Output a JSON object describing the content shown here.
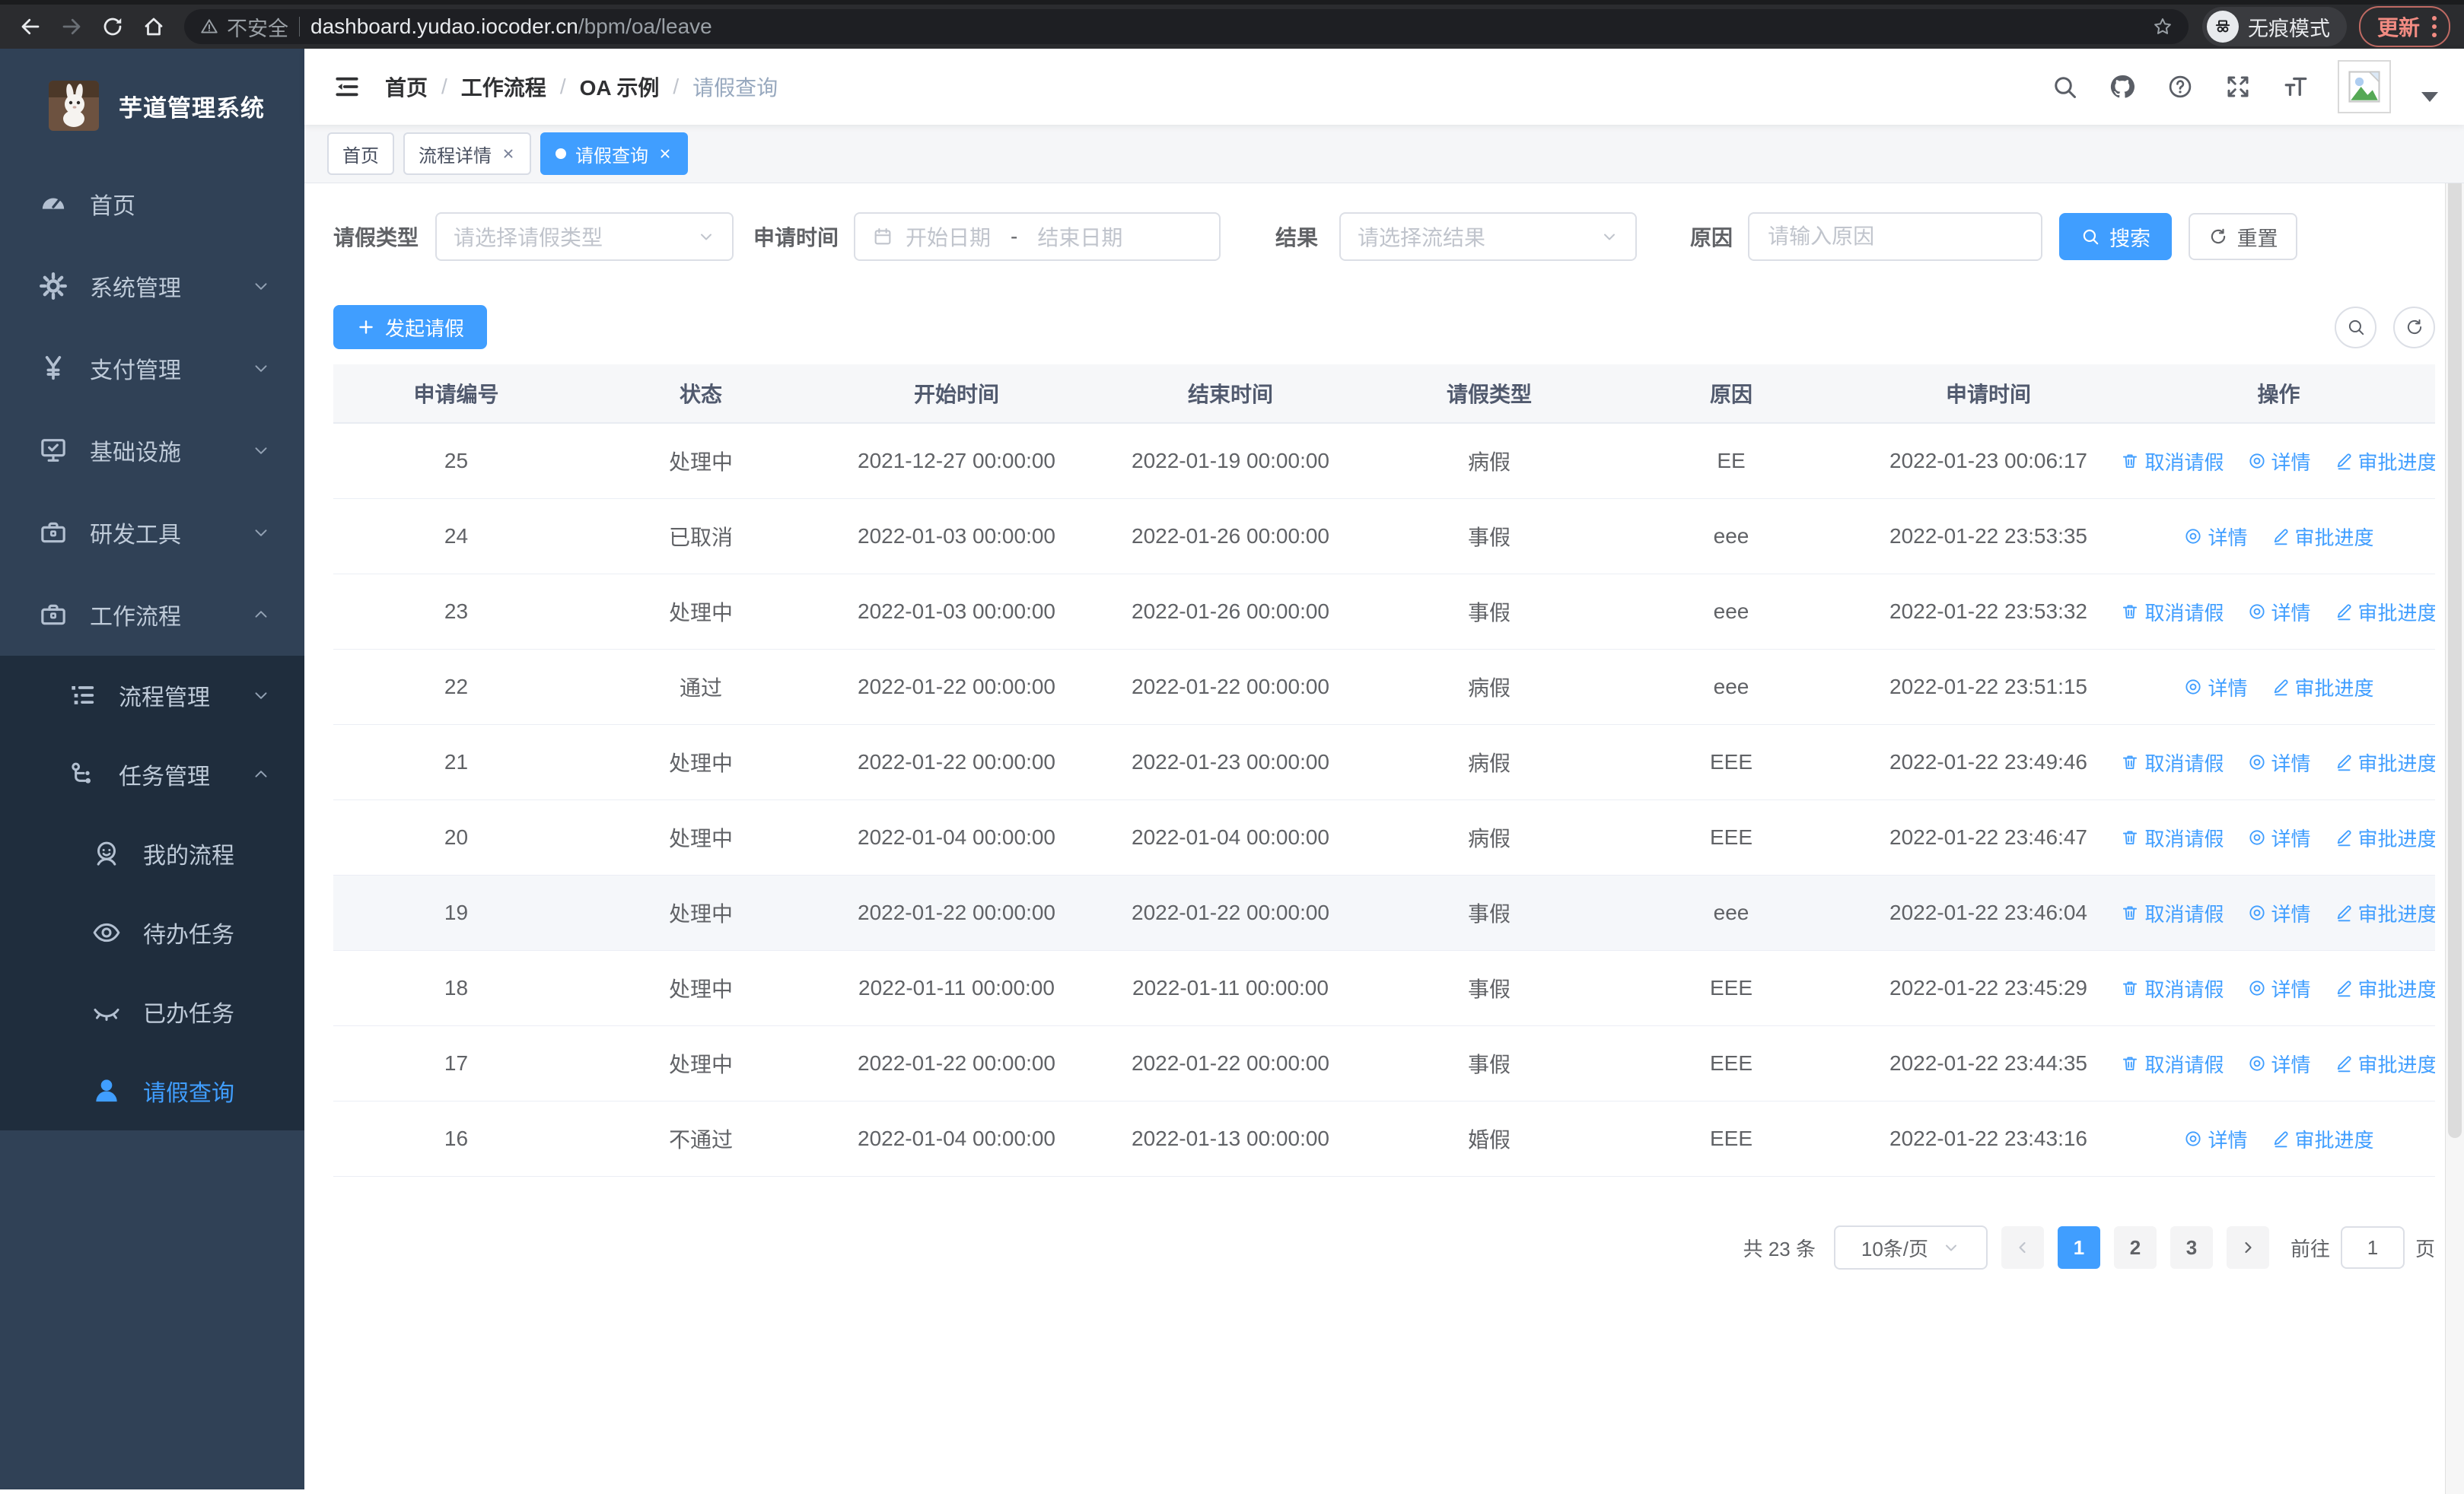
{
  "browser": {
    "security_label": "不安全",
    "url_host": "dashboard.yudao.iocoder.cn",
    "url_path": "/bpm/oa/leave",
    "incognito_label": "无痕模式",
    "update_label": "更新"
  },
  "sidebar": {
    "app_title": "芋道管理系统",
    "menu": [
      {
        "name": "home",
        "label": "首页",
        "icon": "dashboard",
        "depth": 0,
        "chevron": null,
        "sub": false,
        "active": false
      },
      {
        "name": "system-management",
        "label": "系统管理",
        "icon": "gear",
        "depth": 0,
        "chevron": "down",
        "sub": false,
        "active": false
      },
      {
        "name": "payment-management",
        "label": "支付管理",
        "icon": "yen",
        "depth": 0,
        "chevron": "down",
        "sub": false,
        "active": false
      },
      {
        "name": "infrastructure",
        "label": "基础设施",
        "icon": "monitor",
        "depth": 0,
        "chevron": "down",
        "sub": false,
        "active": false
      },
      {
        "name": "dev-tools",
        "label": "研发工具",
        "icon": "toolbox",
        "depth": 0,
        "chevron": "down",
        "sub": false,
        "active": false
      },
      {
        "name": "workflow",
        "label": "工作流程",
        "icon": "briefcase",
        "depth": 0,
        "chevron": "up",
        "sub": false,
        "active": false
      },
      {
        "name": "process-management",
        "label": "流程管理",
        "icon": "list",
        "depth": 1,
        "chevron": "down",
        "sub": true,
        "active": false
      },
      {
        "name": "task-management",
        "label": "任务管理",
        "icon": "tree",
        "depth": 1,
        "chevron": "up",
        "sub": true,
        "active": false
      },
      {
        "name": "my-process",
        "label": "我的流程",
        "icon": "face",
        "depth": 2,
        "chevron": null,
        "sub": true,
        "active": false
      },
      {
        "name": "todo-tasks",
        "label": "待办任务",
        "icon": "eye-open",
        "depth": 2,
        "chevron": null,
        "sub": true,
        "active": false
      },
      {
        "name": "done-tasks",
        "label": "已办任务",
        "icon": "eye-closed",
        "depth": 2,
        "chevron": null,
        "sub": true,
        "active": false
      },
      {
        "name": "leave-query",
        "label": "请假查询",
        "icon": "user",
        "depth": 2,
        "chevron": null,
        "sub": true,
        "active": true
      }
    ]
  },
  "navbar": {
    "separator": "/",
    "breadcrumb": [
      "首页",
      "工作流程",
      "OA 示例",
      "请假查询"
    ]
  },
  "tabs": [
    {
      "name": "home",
      "label": "首页",
      "closable": false,
      "active": false
    },
    {
      "name": "process-detail",
      "label": "流程详情",
      "closable": true,
      "active": false
    },
    {
      "name": "leave-query",
      "label": "请假查询",
      "closable": true,
      "active": true
    }
  ],
  "filters": {
    "type_label": "请假类型",
    "type_placeholder": "请选择请假类型",
    "time_label": "申请时间",
    "date_start_placeholder": "开始日期",
    "date_separator": "-",
    "date_end_placeholder": "结束日期",
    "result_label": "结果",
    "result_placeholder": "请选择流结果",
    "reason_label": "原因",
    "reason_placeholder": "请输入原因",
    "search_label": "搜索",
    "reset_label": "重置"
  },
  "toolbar": {
    "create_label": "发起请假"
  },
  "table": {
    "columns": [
      "申请编号",
      "状态",
      "开始时间",
      "结束时间",
      "请假类型",
      "原因",
      "申请时间",
      "操作"
    ],
    "action_labels": {
      "cancel": "取消请假",
      "detail": "详情",
      "progress": "审批进度"
    },
    "rows": [
      {
        "id": "25",
        "status": "处理中",
        "start": "2021-12-27 00:00:00",
        "end": "2022-01-19 00:00:00",
        "type": "病假",
        "reason": "EE",
        "apply_time": "2022-01-23 00:06:17",
        "actions": [
          "cancel",
          "detail",
          "progress"
        ],
        "hover": false
      },
      {
        "id": "24",
        "status": "已取消",
        "start": "2022-01-03 00:00:00",
        "end": "2022-01-26 00:00:00",
        "type": "事假",
        "reason": "eee",
        "apply_time": "2022-01-22 23:53:35",
        "actions": [
          "detail",
          "progress"
        ],
        "hover": false
      },
      {
        "id": "23",
        "status": "处理中",
        "start": "2022-01-03 00:00:00",
        "end": "2022-01-26 00:00:00",
        "type": "事假",
        "reason": "eee",
        "apply_time": "2022-01-22 23:53:32",
        "actions": [
          "cancel",
          "detail",
          "progress"
        ],
        "hover": false
      },
      {
        "id": "22",
        "status": "通过",
        "start": "2022-01-22 00:00:00",
        "end": "2022-01-22 00:00:00",
        "type": "病假",
        "reason": "eee",
        "apply_time": "2022-01-22 23:51:15",
        "actions": [
          "detail",
          "progress"
        ],
        "hover": false
      },
      {
        "id": "21",
        "status": "处理中",
        "start": "2022-01-22 00:00:00",
        "end": "2022-01-23 00:00:00",
        "type": "病假",
        "reason": "EEE",
        "apply_time": "2022-01-22 23:49:46",
        "actions": [
          "cancel",
          "detail",
          "progress"
        ],
        "hover": false
      },
      {
        "id": "20",
        "status": "处理中",
        "start": "2022-01-04 00:00:00",
        "end": "2022-01-04 00:00:00",
        "type": "病假",
        "reason": "EEE",
        "apply_time": "2022-01-22 23:46:47",
        "actions": [
          "cancel",
          "detail",
          "progress"
        ],
        "hover": false
      },
      {
        "id": "19",
        "status": "处理中",
        "start": "2022-01-22 00:00:00",
        "end": "2022-01-22 00:00:00",
        "type": "事假",
        "reason": "eee",
        "apply_time": "2022-01-22 23:46:04",
        "actions": [
          "cancel",
          "detail",
          "progress"
        ],
        "hover": true
      },
      {
        "id": "18",
        "status": "处理中",
        "start": "2022-01-11 00:00:00",
        "end": "2022-01-11 00:00:00",
        "type": "事假",
        "reason": "EEE",
        "apply_time": "2022-01-22 23:45:29",
        "actions": [
          "cancel",
          "detail",
          "progress"
        ],
        "hover": false
      },
      {
        "id": "17",
        "status": "处理中",
        "start": "2022-01-22 00:00:00",
        "end": "2022-01-22 00:00:00",
        "type": "事假",
        "reason": "EEE",
        "apply_time": "2022-01-22 23:44:35",
        "actions": [
          "cancel",
          "detail",
          "progress"
        ],
        "hover": false
      },
      {
        "id": "16",
        "status": "不通过",
        "start": "2022-01-04 00:00:00",
        "end": "2022-01-13 00:00:00",
        "type": "婚假",
        "reason": "EEE",
        "apply_time": "2022-01-22 23:43:16",
        "actions": [
          "detail",
          "progress"
        ],
        "hover": false
      }
    ]
  },
  "pagination": {
    "total_label": "共 23 条",
    "page_size": "10条/页",
    "pages": [
      "1",
      "2",
      "3"
    ],
    "active_page": "1",
    "goto_label": "前往",
    "goto_value": "1",
    "goto_suffix": "页"
  },
  "colors": {
    "primary": "#409eff",
    "sidebar_bg": "#304156",
    "submenu_bg": "#1f2d3d",
    "sidebar_text": "#bfcbd9",
    "link": "#409eff"
  }
}
